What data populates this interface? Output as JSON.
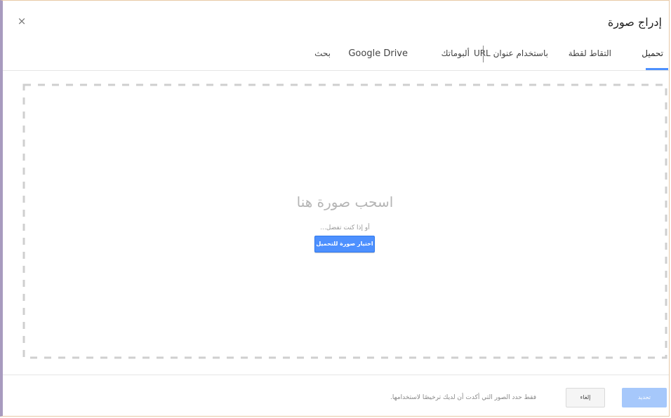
{
  "dialog": {
    "title": "إدراج صورة",
    "close_glyph": "×"
  },
  "tabs": [
    {
      "label": "تحميل",
      "active": true
    },
    {
      "label": "التقاط لقطة",
      "active": false
    },
    {
      "label": "باستخدام عنوان URL",
      "active": false
    },
    {
      "label": "ألبوماتك",
      "active": false
    },
    {
      "label": "Google Drive",
      "active": false
    },
    {
      "label": "بحث",
      "active": false
    }
  ],
  "dropzone": {
    "drag_text": "اسحب صورة هنا",
    "or_text": "أو إذا كنت تفضل...",
    "select_button": "اختيار صورة للتحميل"
  },
  "footer": {
    "note": "فقط حدد الصور التي أكدت أن لديك ترخيصًا لاستخدامها.",
    "cancel_button": "إلغاء",
    "select_button": "تحديد"
  },
  "colors": {
    "accent": "#4d90fe",
    "disabled_accent": "#a6c8fb"
  }
}
